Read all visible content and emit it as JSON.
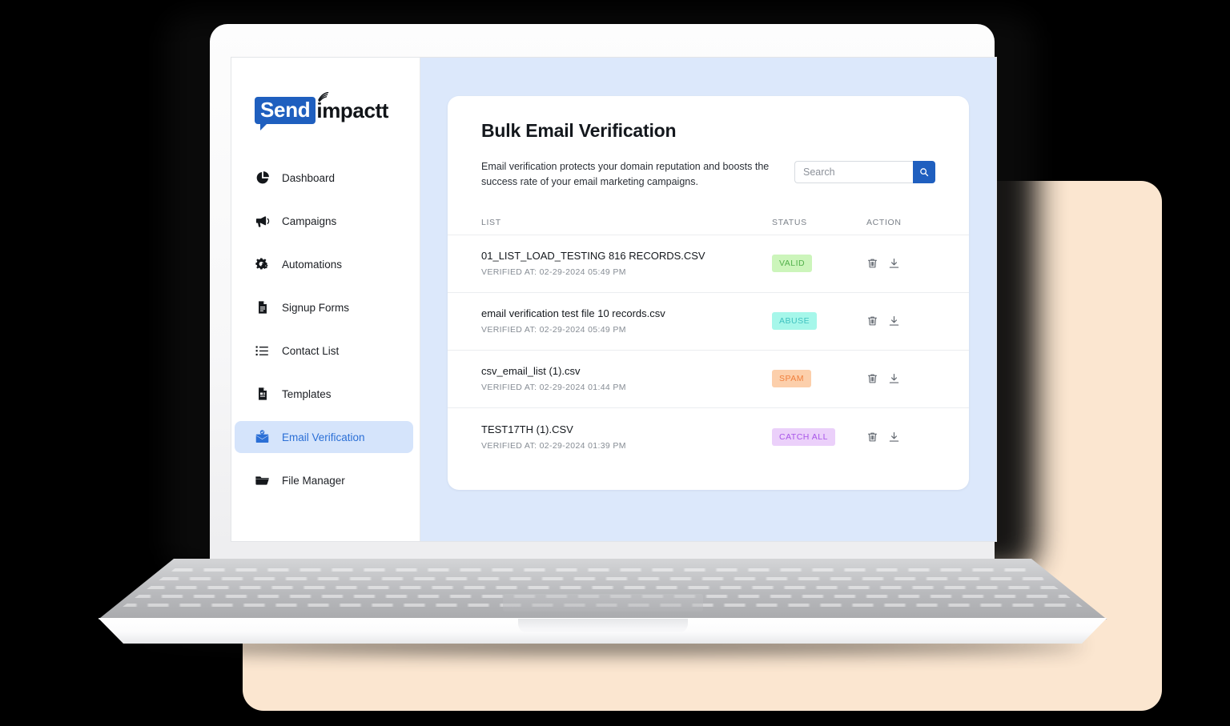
{
  "brand": {
    "logo_mark": "Send",
    "logo_word": "impactt",
    "logo_bg": "#1F5FBF",
    "wifi_icon": "wifi-waves-icon"
  },
  "sidebar": {
    "items": [
      {
        "label": "Dashboard",
        "icon": "pie-chart-icon",
        "active": false
      },
      {
        "label": "Campaigns",
        "icon": "megaphone-icon",
        "active": false
      },
      {
        "label": "Automations",
        "icon": "gears-icon",
        "active": false
      },
      {
        "label": "Signup Forms",
        "icon": "document-icon",
        "active": false
      },
      {
        "label": "Contact List",
        "icon": "list-icon",
        "active": false
      },
      {
        "label": "Templates",
        "icon": "template-icon",
        "active": false
      },
      {
        "label": "Email Verification",
        "icon": "envelope-check-icon",
        "active": true
      },
      {
        "label": "File Manager",
        "icon": "folder-icon",
        "active": false
      }
    ],
    "active_bg": "#D5E4FB",
    "active_color": "#2B6FD6"
  },
  "main": {
    "title": "Bulk Email Verification",
    "description": "Email verification protects your domain reputation and boosts the success rate of your email marketing campaigns.",
    "search": {
      "value": "",
      "placeholder": "Search",
      "button_icon": "search-icon",
      "button_color": "#1F5FBF"
    },
    "table": {
      "columns": [
        "LIST",
        "STATUS",
        "ACTION"
      ],
      "rows": [
        {
          "name": "01_LIST_LOAD_TESTING 816 RECORDS.CSV",
          "verified": "VERIFIED AT: 02-29-2024 05:49 PM",
          "status": "VALID",
          "status_bg": "#CCF5BB",
          "status_color": "#52B14B",
          "actions": [
            "trash-icon",
            "download-icon"
          ]
        },
        {
          "name": "email verification test file 10 records.csv",
          "verified": "VERIFIED AT: 02-29-2024 05:49 PM",
          "status": "ABUSE",
          "status_bg": "#A6F7EA",
          "status_color": "#3FC1C0",
          "actions": [
            "trash-icon",
            "download-icon"
          ]
        },
        {
          "name": "csv_email_list (1).csv",
          "verified": "VERIFIED AT: 02-29-2024 01:44 PM",
          "status": "SPAM",
          "status_bg": "#FCCFAB",
          "status_color": "#F07F3C",
          "actions": [
            "trash-icon",
            "download-icon"
          ]
        },
        {
          "name": "TEST17TH (1).CSV",
          "verified": "VERIFIED AT: 02-29-2024 01:39 PM",
          "status": "CATCH ALL",
          "status_bg": "#EBD0FA",
          "status_color": "#A855E8",
          "actions": [
            "trash-icon",
            "download-icon"
          ]
        }
      ]
    }
  },
  "theme": {
    "page_bg": "#000000",
    "backdrop_panel": "#FBE6D0",
    "app_bg": "#DCE8FB",
    "card_bg": "#FFFFFF"
  }
}
